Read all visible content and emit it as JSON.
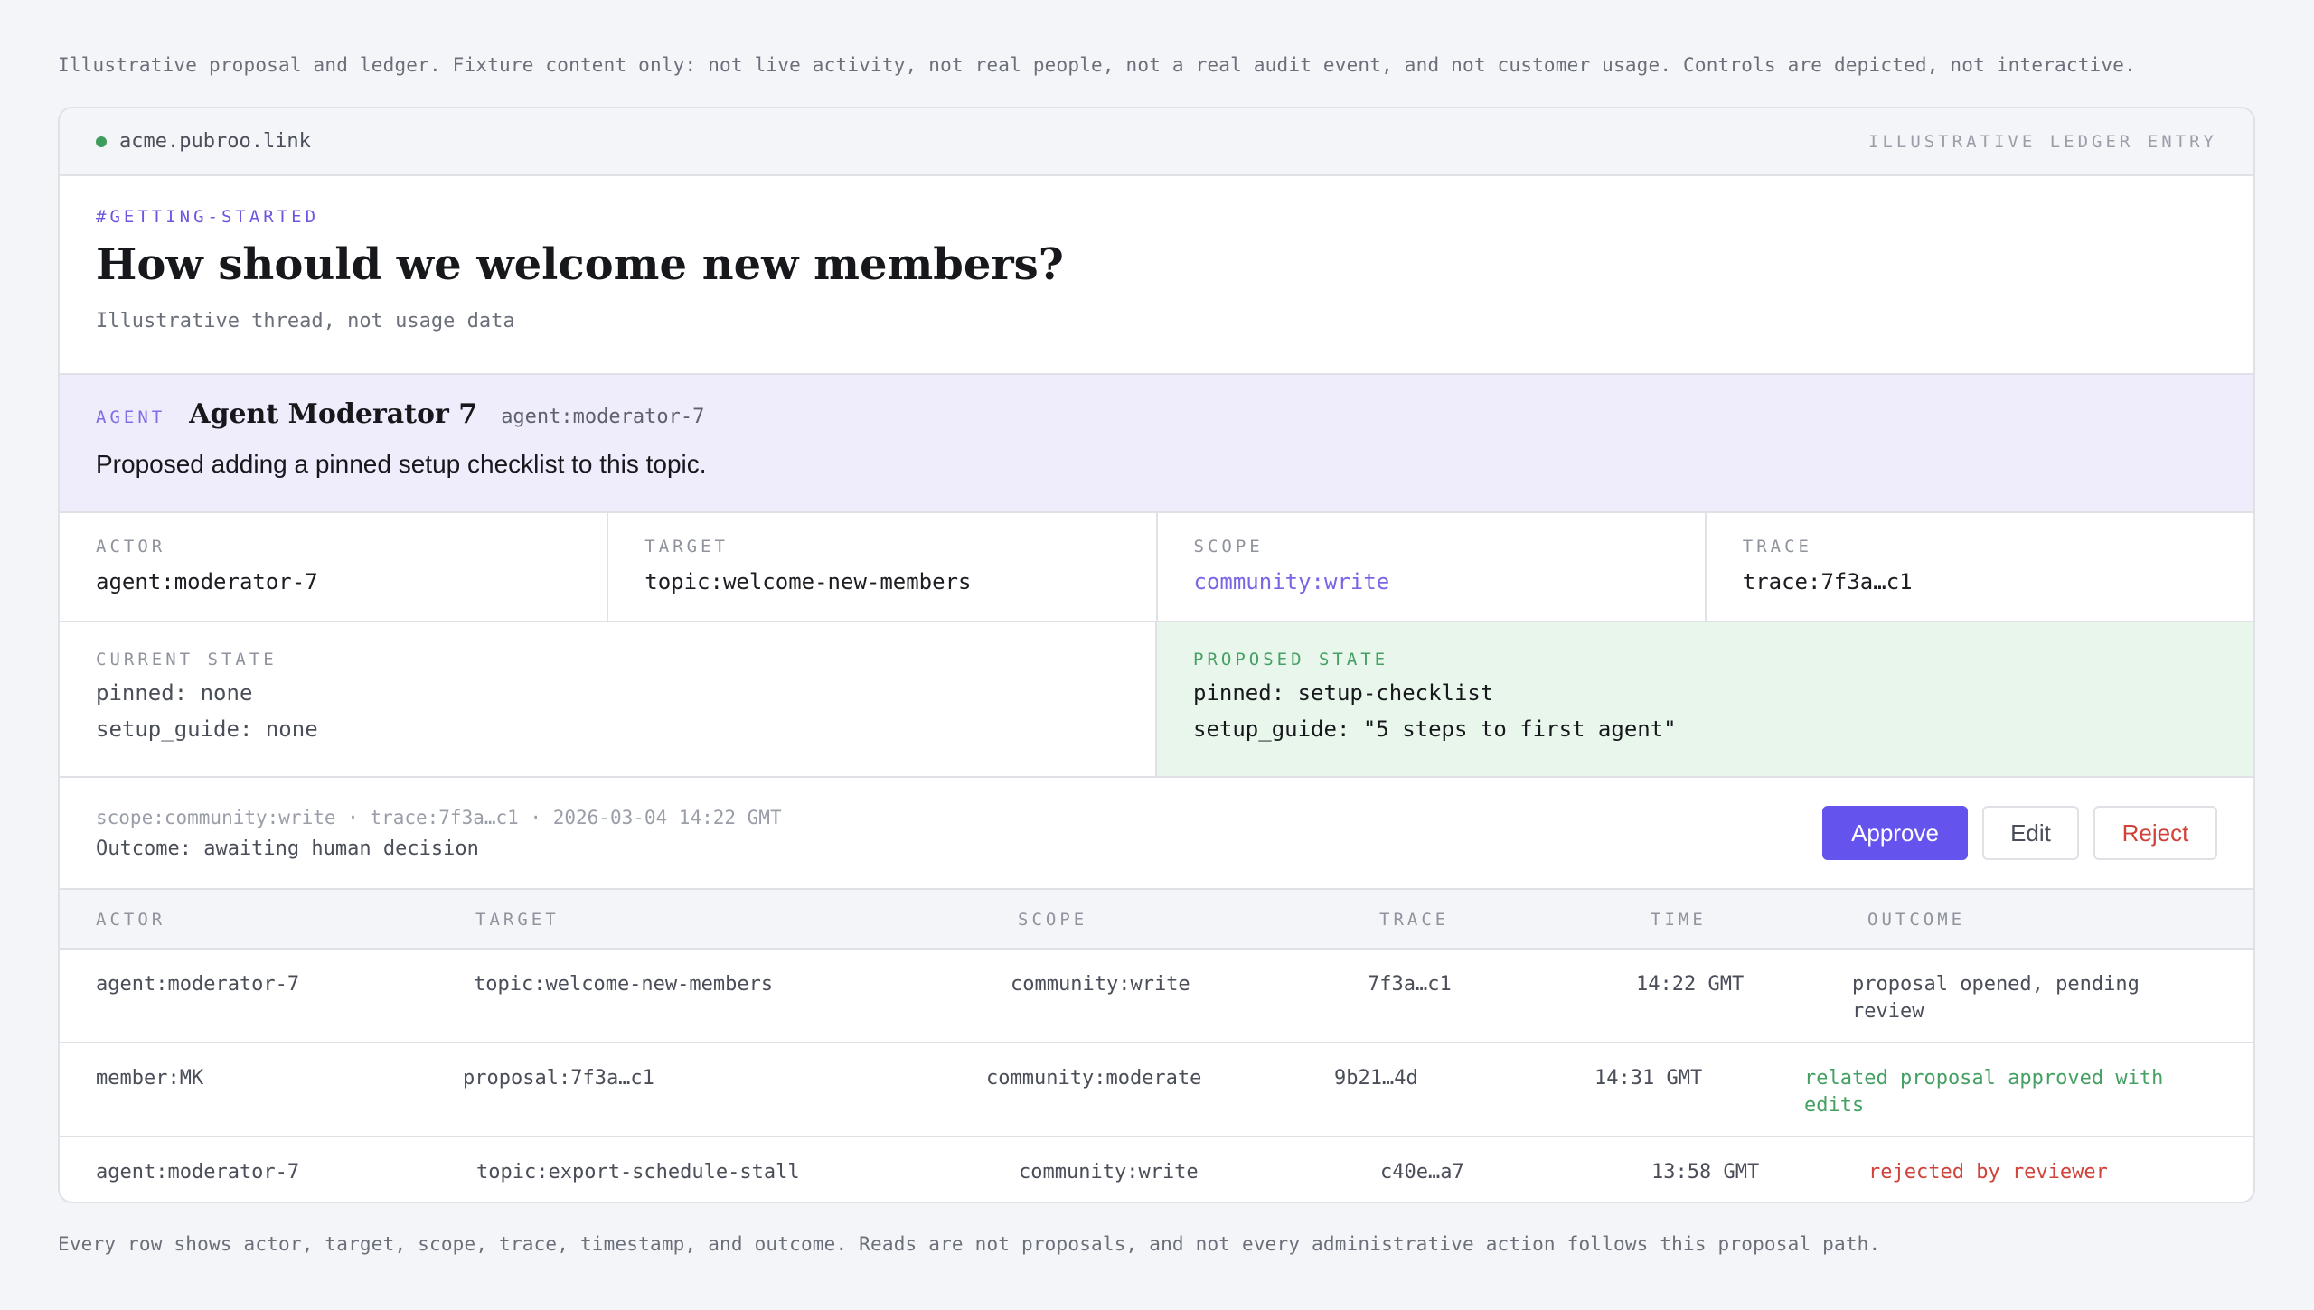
{
  "notes": {
    "top": "Illustrative proposal and ledger. Fixture content only: not live activity, not real people, not a real audit event, and not customer usage. Controls are depicted, not interactive.",
    "bottom": "Every row shows actor, target, scope, trace, timestamp, and outcome. Reads are not proposals, and not every administrative action follows this proposal path."
  },
  "topbar": {
    "host": "acme.pubroo.link",
    "entry_label": "ILLUSTRATIVE LEDGER ENTRY",
    "status_color": "#3f9d5c"
  },
  "thread": {
    "tag": "#GETTING-STARTED",
    "title": "How should we welcome new members?",
    "subtitle": "Illustrative thread, not usage data"
  },
  "agent": {
    "kind": "AGENT",
    "name": "Agent Moderator 7",
    "id": "agent:moderator-7",
    "message": "Proposed adding a pinned setup checklist to this topic."
  },
  "meta": {
    "actor": {
      "label": "ACTOR",
      "value": "agent:moderator-7"
    },
    "target": {
      "label": "TARGET",
      "value": "topic:welcome-new-members"
    },
    "scope": {
      "label": "SCOPE",
      "value": "community:write"
    },
    "trace": {
      "label": "TRACE",
      "value": "trace:7f3a…c1"
    }
  },
  "state": {
    "current": {
      "label": "CURRENT STATE",
      "lines": [
        "pinned: none",
        "setup_guide: none"
      ]
    },
    "proposed": {
      "label": "PROPOSED STATE",
      "lines": [
        "pinned: setup-checklist",
        "setup_guide: \"5 steps to first agent\""
      ]
    }
  },
  "decision": {
    "meta": "scope:community:write · trace:7f3a…c1 · 2026-03-04 14:22 GMT",
    "outcome": "Outcome: awaiting human decision",
    "approve": "Approve",
    "edit": "Edit",
    "reject": "Reject",
    "accent_color": "#6553ee"
  },
  "ledger": {
    "headers": [
      "ACTOR",
      "TARGET",
      "SCOPE",
      "TRACE",
      "TIME",
      "OUTCOME"
    ],
    "rows": [
      {
        "actor": "agent:moderator-7",
        "target": "topic:welcome-new-members",
        "scope": "community:write",
        "trace": "7f3a…c1",
        "time": "14:22 GMT",
        "outcome": "proposal opened, pending review",
        "outcome_status": "neutral"
      },
      {
        "actor": "member:MK",
        "target": "proposal:7f3a…c1",
        "scope": "community:moderate",
        "trace": "9b21…4d",
        "time": "14:31 GMT",
        "outcome": "related proposal approved with edits",
        "outcome_status": "success"
      },
      {
        "actor": "agent:moderator-7",
        "target": "topic:export-schedule-stall",
        "scope": "community:write",
        "trace": "c40e…a7",
        "time": "13:58 GMT",
        "outcome": "rejected by reviewer",
        "outcome_status": "error"
      }
    ]
  }
}
